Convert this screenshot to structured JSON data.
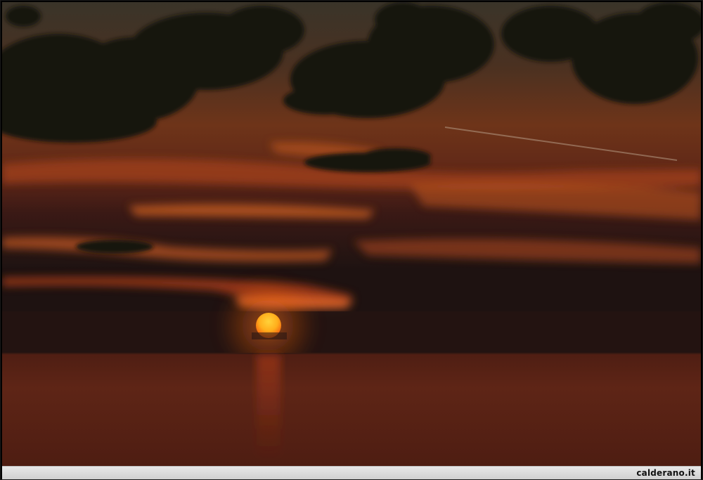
{
  "photo": {
    "subject": "sunset-over-sea",
    "colors": {
      "sky_top": "#2c2219",
      "sky_mid": "#5a2a1b",
      "sky_glow": "#c5521f",
      "horizon_band": "#2a1613",
      "sea": "#5b2415",
      "sun": "#ffb21c",
      "cloud_dark": "#17120f"
    }
  },
  "caption": {
    "watermark": "calderano.it"
  }
}
